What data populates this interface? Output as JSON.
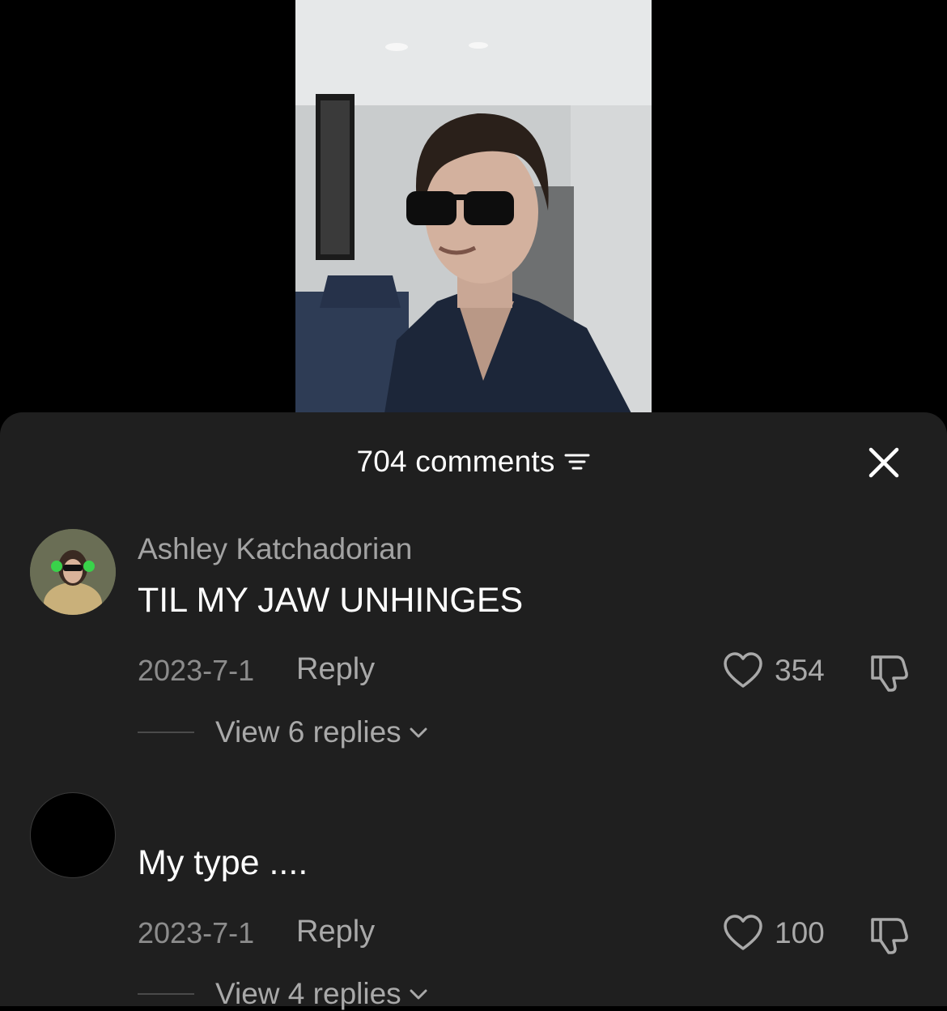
{
  "header": {
    "comment_count_label": "704 comments"
  },
  "comments": [
    {
      "username": "Ashley Katchadorian",
      "text": "TIL MY JAW UNHINGES",
      "date": "2023-7-1",
      "reply_label": "Reply",
      "likes": "354",
      "view_replies_label": "View 6 replies"
    },
    {
      "username": "",
      "text": "My type ....",
      "date": "2023-7-1",
      "reply_label": "Reply",
      "likes": "100",
      "view_replies_label": "View 4 replies"
    }
  ],
  "icons": {
    "sort": "sort-icon",
    "close": "close-icon",
    "like": "heart-outline-icon",
    "dislike": "thumbs-down-icon",
    "expand": "chevron-down-icon"
  },
  "colors": {
    "sheet_background": "#1f1f1f",
    "primary_text": "#ffffff",
    "secondary_text": "#a3a3a3"
  }
}
